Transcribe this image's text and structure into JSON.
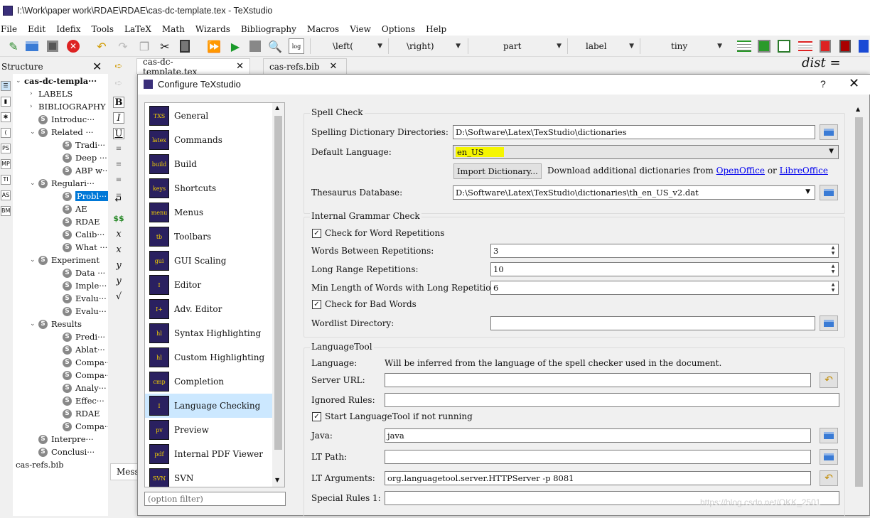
{
  "window": {
    "title": "I:\\Work\\paper work\\RDAE\\RDAE\\cas-dc-template.tex - TeXstudio"
  },
  "menu": [
    "File",
    "Edit",
    "Idefix",
    "Tools",
    "LaTeX",
    "Math",
    "Wizards",
    "Bibliography",
    "Macros",
    "View",
    "Options",
    "Help"
  ],
  "toolbar": {
    "combo_left": "\\left(",
    "combo_right": "\\right)",
    "combo_part": "part",
    "combo_label": "label",
    "combo_size": "tiny"
  },
  "structure": {
    "title": "Structure",
    "items": [
      {
        "label": "cas-dc-templa···",
        "level": 0,
        "exp": "v",
        "icon": false,
        "bold": true
      },
      {
        "label": "LABELS",
        "level": 1,
        "exp": ">",
        "icon": false
      },
      {
        "label": "BIBLIOGRAPHY",
        "level": 1,
        "exp": ">",
        "icon": false
      },
      {
        "label": "Introduc···",
        "level": 1,
        "exp": "",
        "icon": true
      },
      {
        "label": "Related ···",
        "level": 1,
        "exp": "v",
        "icon": true
      },
      {
        "label": "Tradi···",
        "level": 2,
        "exp": "",
        "icon": true
      },
      {
        "label": "Deep ···",
        "level": 2,
        "exp": "",
        "icon": true
      },
      {
        "label": "ABP w···",
        "level": 2,
        "exp": "",
        "icon": true
      },
      {
        "label": "Regulari···",
        "level": 1,
        "exp": "v",
        "icon": true
      },
      {
        "label": "Probl···",
        "level": 2,
        "exp": "",
        "icon": true,
        "selected": true
      },
      {
        "label": "AE",
        "level": 2,
        "exp": "",
        "icon": true
      },
      {
        "label": "RDAE",
        "level": 2,
        "exp": "",
        "icon": true
      },
      {
        "label": "Calib···",
        "level": 2,
        "exp": "",
        "icon": true
      },
      {
        "label": "What ···",
        "level": 2,
        "exp": "",
        "icon": true
      },
      {
        "label": "Experiment",
        "level": 1,
        "exp": "v",
        "icon": true
      },
      {
        "label": "Data ···",
        "level": 2,
        "exp": "",
        "icon": true
      },
      {
        "label": "Imple···",
        "level": 2,
        "exp": "",
        "icon": true
      },
      {
        "label": "Evalu···",
        "level": 2,
        "exp": "",
        "icon": true
      },
      {
        "label": "Evalu···",
        "level": 2,
        "exp": "",
        "icon": true
      },
      {
        "label": "Results",
        "level": 1,
        "exp": "v",
        "icon": true
      },
      {
        "label": "Predi···",
        "level": 2,
        "exp": "",
        "icon": true
      },
      {
        "label": "Ablat···",
        "level": 2,
        "exp": "",
        "icon": true
      },
      {
        "label": "Compa···",
        "level": 2,
        "exp": "",
        "icon": true
      },
      {
        "label": "Compa···",
        "level": 2,
        "exp": "",
        "icon": true
      },
      {
        "label": "Analy···",
        "level": 2,
        "exp": "",
        "icon": true
      },
      {
        "label": "Effec···",
        "level": 2,
        "exp": "",
        "icon": true
      },
      {
        "label": "RDAE",
        "level": 2,
        "exp": "",
        "icon": true
      },
      {
        "label": "Compa···",
        "level": 2,
        "exp": "",
        "icon": true
      },
      {
        "label": "Interpre···",
        "level": 1,
        "exp": "",
        "icon": true
      },
      {
        "label": "Conclusi···",
        "level": 1,
        "exp": "",
        "icon": true
      },
      {
        "label": "cas-refs.bib",
        "level": 0,
        "exp": "",
        "icon": false
      }
    ]
  },
  "tabs": [
    {
      "label": "cas-dc-template.tex"
    },
    {
      "label": "cas-refs.bib"
    }
  ],
  "formula_text": "dist =",
  "messages_tab": "Mess",
  "dialog": {
    "title": "Configure TeXstudio",
    "help": "?",
    "categories": [
      {
        "label": "General",
        "icon": "TXS"
      },
      {
        "label": "Commands",
        "icon": "latex"
      },
      {
        "label": "Build",
        "icon": "build"
      },
      {
        "label": "Shortcuts",
        "icon": "keys"
      },
      {
        "label": "Menus",
        "icon": "menu"
      },
      {
        "label": "Toolbars",
        "icon": "tb"
      },
      {
        "label": "GUI Scaling",
        "icon": "gui"
      },
      {
        "label": "Editor",
        "icon": "I"
      },
      {
        "label": "Adv. Editor",
        "icon": "I+"
      },
      {
        "label": "Syntax Highlighting",
        "icon": "hl"
      },
      {
        "label": "Custom Highlighting",
        "icon": "hl"
      },
      {
        "label": "Completion",
        "icon": "cmp"
      },
      {
        "label": "Language Checking",
        "icon": "I",
        "selected": true
      },
      {
        "label": "Preview",
        "icon": "pv"
      },
      {
        "label": "Internal PDF Viewer",
        "icon": "pdf"
      },
      {
        "label": "SVN",
        "icon": "SVN"
      }
    ],
    "filter_placeholder": "(option filter)",
    "spell": {
      "group": "Spell Check",
      "dict_dirs_label": "Spelling Dictionary Directories:",
      "dict_dirs_value": "D:\\Software\\Latex\\TexStudio\\dictionaries",
      "default_lang_label": "Default Language:",
      "default_lang_value": "en_US",
      "import_button": "Import Dictionary...",
      "download_text": "Download additional dictionaries from",
      "link_openoffice": "OpenOffice",
      "or_text": "or",
      "link_libreoffice": "LibreOffice",
      "thesaurus_label": "Thesaurus Database:",
      "thesaurus_value": "D:\\Software\\Latex\\TexStudio\\dictionaries\\th_en_US_v2.dat"
    },
    "grammar": {
      "group": "Internal Grammar Check",
      "check_repetitions": "Check for Word Repetitions",
      "words_between_label": "Words Between Repetitions:",
      "words_between_value": "3",
      "long_range_label": "Long Range Repetitions:",
      "long_range_value": "10",
      "min_length_label": "Min Length of Words with Long Repetition:",
      "min_length_value": "6",
      "check_bad_words": "Check for Bad Words",
      "wordlist_label": "Wordlist Directory:",
      "wordlist_value": ""
    },
    "langtool": {
      "group": "LanguageTool",
      "language_label": "Language:",
      "language_text": "Will be inferred from the language of the spell checker used in the document.",
      "server_label": "Server URL:",
      "server_value": "",
      "ignored_label": "Ignored Rules:",
      "ignored_value": "",
      "start_lt": "Start LanguageTool if not running",
      "java_label": "Java:",
      "java_value": "java",
      "ltpath_label": "LT Path:",
      "ltpath_value": "",
      "ltargs_label": "LT Arguments:",
      "ltargs_value": "org.languagetool.server.HTTPServer -p 8081",
      "special_label": "Special Rules 1:",
      "special_value": ""
    }
  },
  "watermark": "https://blog.csdn.net/OKK_2501",
  "colors": {
    "selection": "#0078d7",
    "highlight": "#f5f500",
    "link": "#0000ee"
  }
}
